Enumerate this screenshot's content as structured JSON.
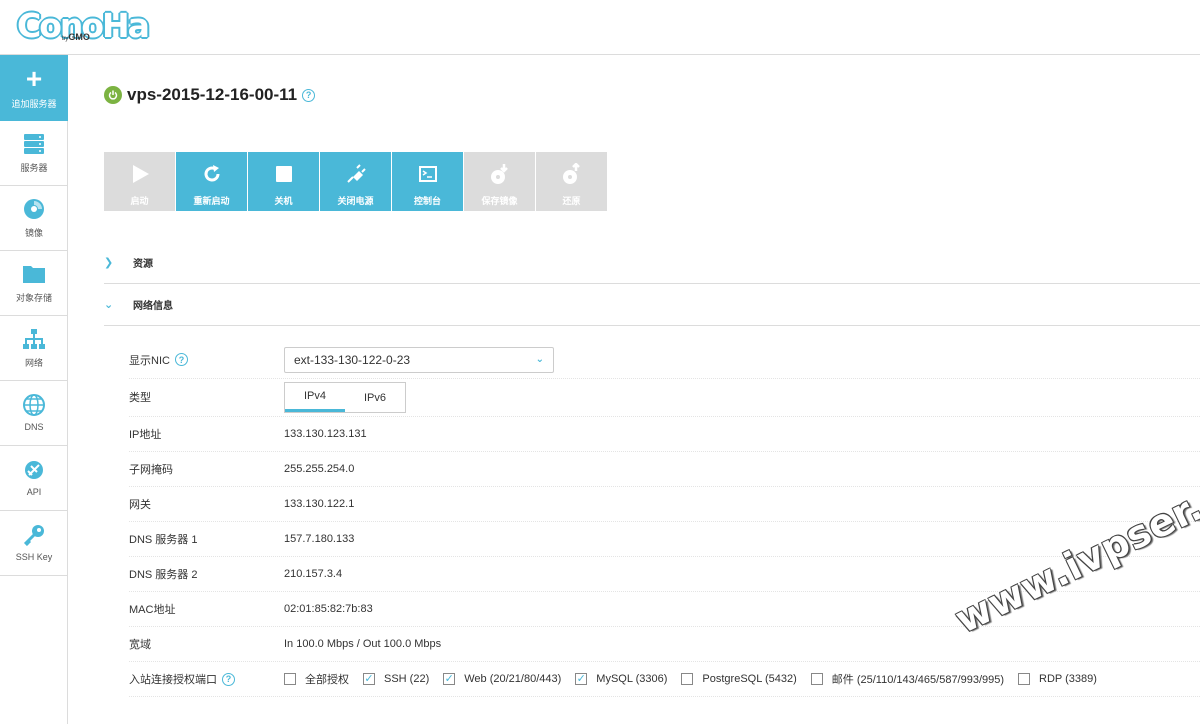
{
  "logo": {
    "main": "ConoHa",
    "by": "by",
    "brand": "GMO"
  },
  "sidebar": {
    "add": "追加服务器",
    "items": [
      {
        "label": "服务器",
        "icon": "server-icon"
      },
      {
        "label": "镜像",
        "icon": "disc-icon"
      },
      {
        "label": "对象存储",
        "icon": "folder-icon"
      },
      {
        "label": "网络",
        "icon": "network-icon"
      },
      {
        "label": "DNS",
        "icon": "globe-icon"
      },
      {
        "label": "API",
        "icon": "plug-icon"
      },
      {
        "label": "SSH Key",
        "icon": "key-icon"
      }
    ]
  },
  "server": {
    "name": "vps-2015-12-16-00-11",
    "status_color": "#7cb342"
  },
  "help_mark": "?",
  "toolbar": {
    "start": "启动",
    "restart": "重新启动",
    "shutdown": "关机",
    "power_off": "关闭电源",
    "console": "控制台",
    "save_image": "保存镜像",
    "restore": "还原"
  },
  "sections": {
    "resources": "资源",
    "network": "网络信息"
  },
  "network": {
    "nic_label": "显示NIC",
    "nic_value": "ext-133-130-122-0-23",
    "type_label": "类型",
    "tab_ipv4": "IPv4",
    "tab_ipv6": "IPv6",
    "ip_label": "IP地址",
    "ip_value": "133.130.123.131",
    "mask_label": "子网掩码",
    "mask_value": "255.255.254.0",
    "gateway_label": "网关",
    "gateway_value": "133.130.122.1",
    "dns1_label": "DNS 服务器 1",
    "dns1_value": "157.7.180.133",
    "dns2_label": "DNS 服务器 2",
    "dns2_value": "210.157.3.4",
    "mac_label": "MAC地址",
    "mac_value": "02:01:85:82:7b:83",
    "bandwidth_label": "宽域",
    "bandwidth_value": "In 100.0 Mbps / Out 100.0 Mbps",
    "ports_label": "入站连接授权端口",
    "ports": [
      {
        "label": "全部授权",
        "checked": false
      },
      {
        "label": "SSH (22)",
        "checked": true
      },
      {
        "label": "Web (20/21/80/443)",
        "checked": true
      },
      {
        "label": "MySQL (3306)",
        "checked": true
      },
      {
        "label": "PostgreSQL (5432)",
        "checked": false
      },
      {
        "label": "邮件 (25/110/143/465/587/993/995)",
        "checked": false
      },
      {
        "label": "RDP (3389)",
        "checked": false
      }
    ]
  },
  "watermark": "www.ivpser.com",
  "colors": {
    "accent": "#4ab8d8",
    "disabled": "#dcdcdc",
    "power": "#7cb342"
  }
}
